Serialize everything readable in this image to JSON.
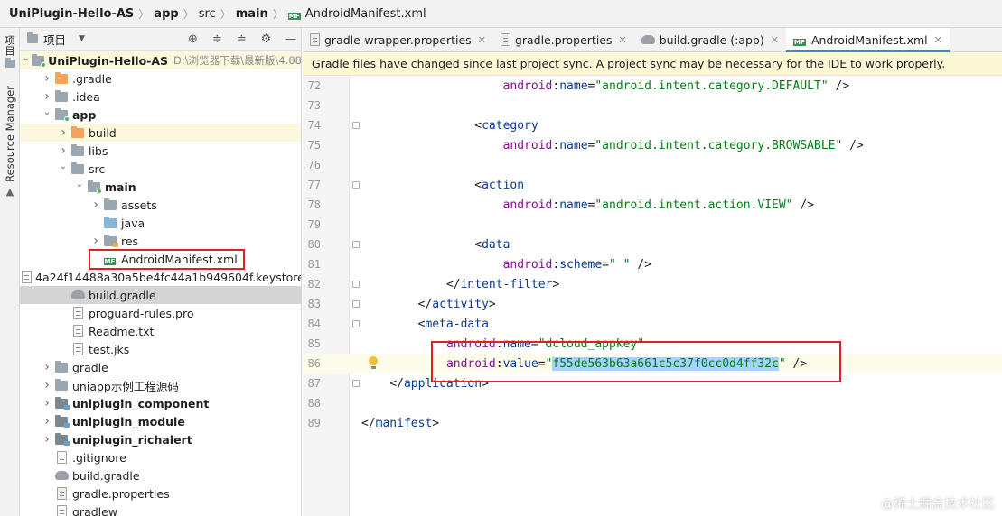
{
  "breadcrumb": {
    "project": "UniPlugin-Hello-AS",
    "items": [
      "app",
      "src",
      "main"
    ],
    "file": "AndroidManifest.xml"
  },
  "tool_stripe": {
    "project_tool_label": "项目",
    "resource_manager_label": "Resource Manager"
  },
  "project_panel": {
    "title": "项目",
    "tree": [
      {
        "label": "UniPlugin-Hello-AS",
        "path": "D:\\浏览器下载\\最新版\\4.08",
        "bold": true,
        "icon": "module-folder-icon",
        "arrow": "expanded",
        "indent": 0
      },
      {
        "label": ".gradle",
        "icon": "folder-orange-icon",
        "arrow": "collapsed",
        "indent": 1
      },
      {
        "label": ".idea",
        "icon": "folder-gray-icon",
        "arrow": "collapsed",
        "indent": 1
      },
      {
        "label": "app",
        "bold": true,
        "icon": "module-folder-icon",
        "arrow": "expanded",
        "indent": 1
      },
      {
        "label": "build",
        "icon": "folder-orange-icon",
        "arrow": "collapsed",
        "indent": 2
      },
      {
        "label": "libs",
        "icon": "folder-gray-icon",
        "arrow": "collapsed",
        "indent": 2
      },
      {
        "label": "src",
        "icon": "folder-gray-icon",
        "arrow": "expanded",
        "indent": 2
      },
      {
        "label": "main",
        "bold": true,
        "icon": "module-folder-icon",
        "arrow": "expanded",
        "indent": 3
      },
      {
        "label": "assets",
        "icon": "folder-gray-icon",
        "arrow": "collapsed",
        "indent": 4
      },
      {
        "label": "java",
        "icon": "folder-blue-icon",
        "arrow": "none",
        "indent": 4
      },
      {
        "label": "res",
        "icon": "res-folder-icon",
        "arrow": "collapsed",
        "indent": 4
      },
      {
        "label": "AndroidManifest.xml",
        "icon": "manifest-icon",
        "arrow": "none",
        "indent": 4
      },
      {
        "label": "4a24f14488a30a5be4fc44a1b949604f.keystore",
        "icon": "file-icon",
        "arrow": "none",
        "indent": 2
      },
      {
        "label": "build.gradle",
        "icon": "gradle-icon",
        "arrow": "none",
        "indent": 2,
        "selected": true
      },
      {
        "label": "proguard-rules.pro",
        "icon": "file-icon",
        "arrow": "none",
        "indent": 2
      },
      {
        "label": "Readme.txt",
        "icon": "file-icon",
        "arrow": "none",
        "indent": 2
      },
      {
        "label": "test.jks",
        "icon": "file-icon",
        "arrow": "none",
        "indent": 2
      },
      {
        "label": "gradle",
        "icon": "folder-gray-icon",
        "arrow": "collapsed",
        "indent": 1
      },
      {
        "label": "uniapp示例工程源码",
        "icon": "folder-gray-icon",
        "arrow": "collapsed",
        "indent": 1
      },
      {
        "label": "uniplugin_component",
        "bold": true,
        "icon": "module-icon",
        "arrow": "collapsed",
        "indent": 1
      },
      {
        "label": "uniplugin_module",
        "bold": true,
        "icon": "module-icon",
        "arrow": "collapsed",
        "indent": 1
      },
      {
        "label": "uniplugin_richalert",
        "bold": true,
        "icon": "module-icon",
        "arrow": "collapsed",
        "indent": 1
      },
      {
        "label": ".gitignore",
        "icon": "file-icon",
        "arrow": "none",
        "indent": 1
      },
      {
        "label": "build.gradle",
        "icon": "gradle-icon",
        "arrow": "none",
        "indent": 1
      },
      {
        "label": "gradle.properties",
        "icon": "properties-icon",
        "arrow": "none",
        "indent": 1
      },
      {
        "label": "gradlew",
        "icon": "file-icon",
        "arrow": "none",
        "indent": 1
      }
    ]
  },
  "tabs": [
    {
      "label": "gradle-wrapper.properties",
      "icon": "properties-icon",
      "active": false
    },
    {
      "label": "gradle.properties",
      "icon": "properties-icon",
      "active": false
    },
    {
      "label": "build.gradle (:app)",
      "icon": "gradle-icon",
      "active": false
    },
    {
      "label": "AndroidManifest.xml",
      "icon": "manifest-icon",
      "active": true
    }
  ],
  "notification": "Gradle files have changed since last project sync. A project sync may be necessary for the IDE to work properly.",
  "code": {
    "lines": [
      {
        "n": "72",
        "indent": 10,
        "segs": [
          [
            "attr-ns",
            "android"
          ],
          [
            "punct",
            ":"
          ],
          [
            "attr-name",
            "name"
          ],
          [
            "eq",
            "="
          ],
          [
            "str",
            "\"android.intent.category.DEFAULT\""
          ],
          [
            "punct",
            " />"
          ]
        ]
      },
      {
        "n": "73",
        "indent": 0,
        "segs": []
      },
      {
        "n": "74",
        "indent": 8,
        "fold": true,
        "segs": [
          [
            "punct",
            "<"
          ],
          [
            "tag",
            "category"
          ]
        ]
      },
      {
        "n": "75",
        "indent": 10,
        "segs": [
          [
            "attr-ns",
            "android"
          ],
          [
            "punct",
            ":"
          ],
          [
            "attr-name",
            "name"
          ],
          [
            "eq",
            "="
          ],
          [
            "str",
            "\"android.intent.category.BROWSABLE\""
          ],
          [
            "punct",
            " />"
          ]
        ]
      },
      {
        "n": "76",
        "indent": 0,
        "segs": []
      },
      {
        "n": "77",
        "indent": 8,
        "fold": true,
        "segs": [
          [
            "punct",
            "<"
          ],
          [
            "tag",
            "action"
          ]
        ]
      },
      {
        "n": "78",
        "indent": 10,
        "segs": [
          [
            "attr-ns",
            "android"
          ],
          [
            "punct",
            ":"
          ],
          [
            "attr-name",
            "name"
          ],
          [
            "eq",
            "="
          ],
          [
            "str",
            "\"android.intent.action.VIEW\""
          ],
          [
            "punct",
            " />"
          ]
        ]
      },
      {
        "n": "79",
        "indent": 0,
        "segs": []
      },
      {
        "n": "80",
        "indent": 8,
        "fold": true,
        "segs": [
          [
            "punct",
            "<"
          ],
          [
            "tag",
            "data"
          ]
        ]
      },
      {
        "n": "81",
        "indent": 10,
        "segs": [
          [
            "attr-ns",
            "android"
          ],
          [
            "punct",
            ":"
          ],
          [
            "attr-name",
            "scheme"
          ],
          [
            "eq",
            "="
          ],
          [
            "str",
            "\" \""
          ],
          [
            "punct",
            " />"
          ]
        ]
      },
      {
        "n": "82",
        "indent": 6,
        "fold": true,
        "segs": [
          [
            "punct",
            "</"
          ],
          [
            "tag",
            "intent-filter"
          ],
          [
            "punct",
            ">"
          ]
        ]
      },
      {
        "n": "83",
        "indent": 4,
        "fold": true,
        "segs": [
          [
            "punct",
            "</"
          ],
          [
            "tag",
            "activity"
          ],
          [
            "punct",
            ">"
          ]
        ]
      },
      {
        "n": "84",
        "indent": 4,
        "fold": true,
        "segs": [
          [
            "punct",
            "<"
          ],
          [
            "tag",
            "meta-data"
          ]
        ]
      },
      {
        "n": "85",
        "indent": 6,
        "segs": [
          [
            "attr-ns",
            "android"
          ],
          [
            "punct",
            ":"
          ],
          [
            "attr-name",
            "name"
          ],
          [
            "eq",
            "="
          ],
          [
            "str",
            "\"dcloud_appkey\""
          ]
        ]
      },
      {
        "n": "86",
        "indent": 6,
        "current": true,
        "bulb": true,
        "segs": [
          [
            "attr-ns",
            "android"
          ],
          [
            "punct",
            ":"
          ],
          [
            "attr-name",
            "value"
          ],
          [
            "eq",
            "="
          ],
          [
            "str",
            "\""
          ],
          [
            "str sel",
            "f55de563b63a661c5c37f0cc0d4ff32c"
          ],
          [
            "str",
            "\""
          ],
          [
            "punct",
            " />"
          ]
        ]
      },
      {
        "n": "87",
        "indent": 2,
        "fold": true,
        "segs": [
          [
            "punct",
            "</"
          ],
          [
            "tag",
            "application"
          ],
          [
            "punct",
            ">"
          ]
        ]
      },
      {
        "n": "88",
        "indent": 0,
        "segs": []
      },
      {
        "n": "89",
        "indent": 0,
        "segs": [
          [
            "punct",
            "</"
          ],
          [
            "tag",
            "manifest"
          ],
          [
            "punct",
            ">"
          ]
        ]
      }
    ]
  },
  "watermark": "@稀土掘金技术社区",
  "colors": {
    "accent": "#4083c9",
    "annotation": "#e02020",
    "notification_bg": "#fcf7d4"
  }
}
